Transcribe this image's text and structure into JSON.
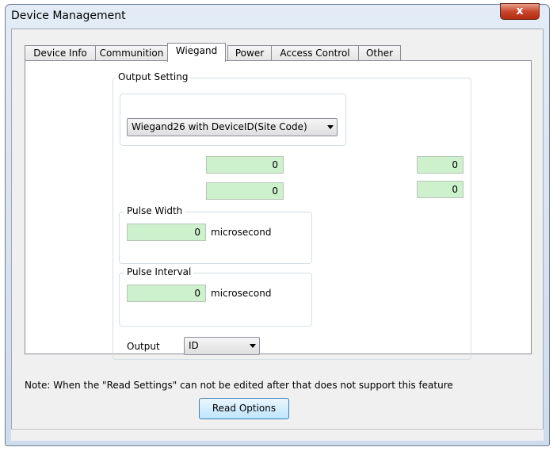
{
  "window": {
    "title": "Device Management",
    "close_label": "x"
  },
  "tabs": [
    {
      "label": "Device Info",
      "active": false
    },
    {
      "label": "Communition",
      "active": false
    },
    {
      "label": "Wiegand",
      "active": true
    },
    {
      "label": "Power",
      "active": false
    },
    {
      "label": "Access Control",
      "active": false
    },
    {
      "label": "Other",
      "active": false
    }
  ],
  "output_setting": {
    "group_label": "Output Setting",
    "format_select": "Wiegand26 with DeviceID(Site Code)",
    "fields": [
      "0",
      "0",
      "0",
      "0"
    ]
  },
  "pulse_width": {
    "group_label": "Pulse Width",
    "value": "0",
    "unit": "microsecond"
  },
  "pulse_interval": {
    "group_label": "Pulse Interval",
    "value": "0",
    "unit": "microsecond"
  },
  "output": {
    "label": "Output",
    "selected": "ID"
  },
  "note": "Note: When the \"Read Settings\" can not be edited after that does not support this feature",
  "read_button": "Read Options",
  "colors": {
    "field_bg": "#cdf0cd",
    "title_bar": "#dbe6f3",
    "close_button": "#c8462c"
  }
}
